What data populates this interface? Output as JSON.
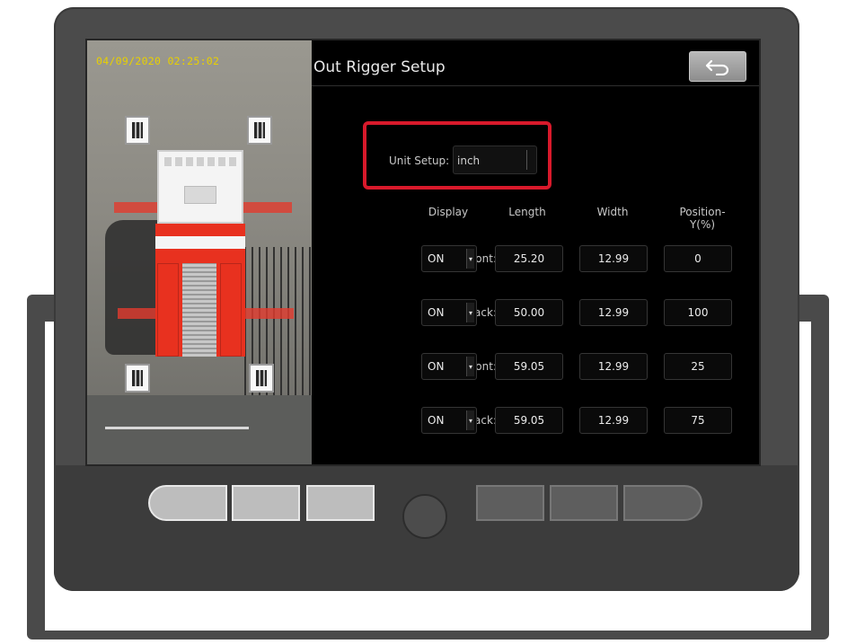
{
  "camera": {
    "timestamp": "04/09/2020 02:25:02"
  },
  "panel": {
    "title": "Out Rigger Setup",
    "back_icon": "back-arrow-icon",
    "unit_setup": {
      "label": "Unit Setup:",
      "value": "inch"
    },
    "columns": [
      "Display",
      "Length",
      "Width",
      "Position-Y(%)"
    ],
    "rows": [
      {
        "label": "Left Front:",
        "display": "ON",
        "length": "25.20",
        "width": "12.99",
        "position_y": "0"
      },
      {
        "label": "Left Back:",
        "display": "ON",
        "length": "50.00",
        "width": "12.99",
        "position_y": "100"
      },
      {
        "label": "Right Front:",
        "display": "ON",
        "length": "59.05",
        "width": "12.99",
        "position_y": "25"
      },
      {
        "label": "Right Back:",
        "display": "ON",
        "length": "59.05",
        "width": "12.99",
        "position_y": "75"
      }
    ]
  },
  "colors": {
    "highlight": "#d8192b",
    "timestamp": "#e8d000",
    "truck_body": "#e8311f"
  }
}
